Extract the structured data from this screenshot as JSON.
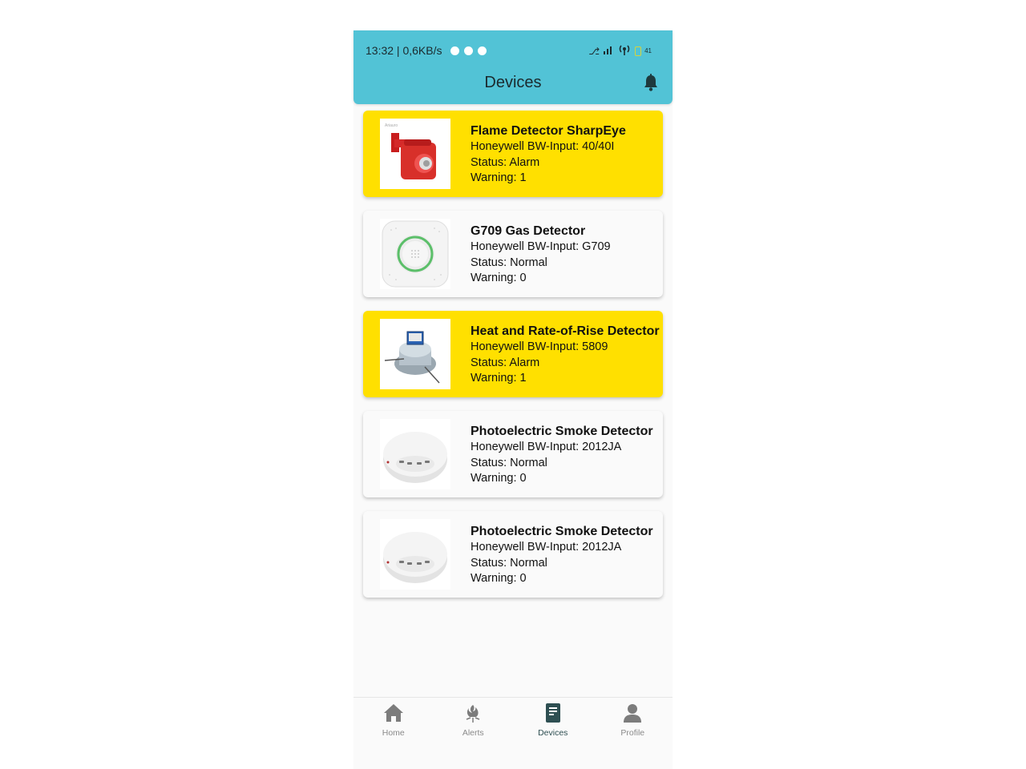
{
  "status_bar": {
    "time": "13:32 | 0,6KB/s",
    "battery": "41"
  },
  "header": {
    "title": "Devices"
  },
  "devices": [
    {
      "name": "Flame Detector SharpEye",
      "input": "Honeywell BW-Input: 40/40I",
      "status": "Status: Alarm",
      "warning": "Warning: 1",
      "state": "alarm",
      "image_icon": "flame-detector-image"
    },
    {
      "name": "G709 Gas Detector",
      "input": "Honeywell BW-Input: G709",
      "status": "Status: Normal",
      "warning": "Warning: 0",
      "state": "normal",
      "image_icon": "gas-detector-image"
    },
    {
      "name": "Heat and Rate-of-Rise Detector",
      "input": "Honeywell BW-Input: 5809",
      "status": "Status: Alarm",
      "warning": "Warning: 1",
      "state": "alarm",
      "image_icon": "heat-detector-image"
    },
    {
      "name": "Photoelectric Smoke Detector",
      "input": "Honeywell BW-Input: 2012JA",
      "status": "Status: Normal",
      "warning": "Warning: 0",
      "state": "normal",
      "image_icon": "smoke-detector-image"
    },
    {
      "name": "Photoelectric Smoke Detector",
      "input": "Honeywell BW-Input: 2012JA",
      "status": "Status: Normal",
      "warning": "Warning: 0",
      "state": "normal",
      "image_icon": "smoke-detector-image"
    }
  ],
  "bottom_nav": {
    "items": [
      {
        "label": "Home",
        "icon": "home-icon",
        "active": false
      },
      {
        "label": "Alerts",
        "icon": "alerts-icon",
        "active": false
      },
      {
        "label": "Devices",
        "icon": "devices-icon",
        "active": true
      },
      {
        "label": "Profile",
        "icon": "profile-icon",
        "active": false
      }
    ]
  },
  "colors": {
    "header": "#52c3d6",
    "alarm_card": "#ffe000",
    "normal_card": "#fafafa",
    "active_nav": "#2e4f52",
    "inactive_nav": "#8a8a8a"
  }
}
